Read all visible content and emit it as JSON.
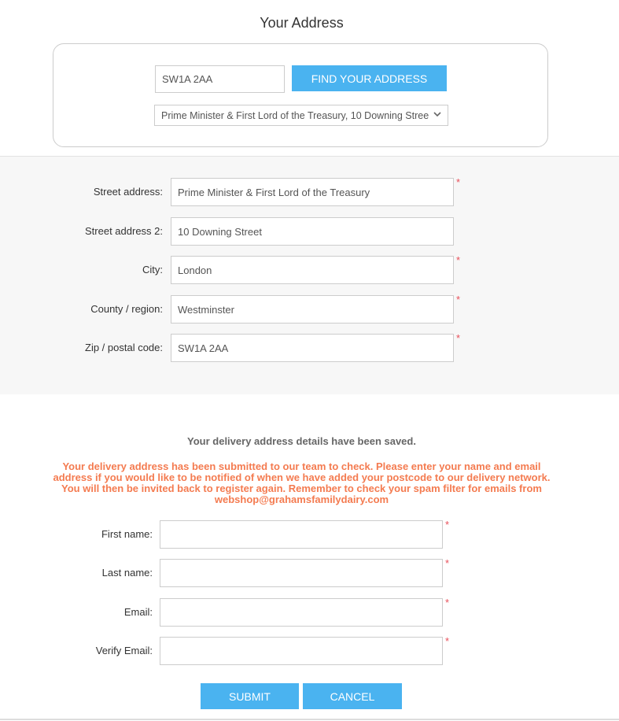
{
  "header": {
    "title": "Your Address"
  },
  "lookup": {
    "postcode_value": "SW1A 2AA",
    "find_button_label": "FIND YOUR ADDRESS",
    "selected_address": "Prime Minister & First Lord of the Treasury, 10 Downing Stree"
  },
  "address_fields": [
    {
      "label": "Street address:",
      "value": "Prime Minister & First Lord of the Treasury",
      "required": true
    },
    {
      "label": "Street address 2:",
      "value": "10 Downing Street",
      "required": false
    },
    {
      "label": "City:",
      "value": "London",
      "required": true
    },
    {
      "label": "County / region:",
      "value": "Westminster",
      "required": true
    },
    {
      "label": "Zip / postal code:",
      "value": "SW1A 2AA",
      "required": true
    }
  ],
  "messages": {
    "saved": "Your delivery address details have been saved.",
    "notice_lines": [
      "Your delivery address has been submitted to our team to check.  Please enter your name and email",
      "address if you would like to be notified of when we have added your postcode to our delivery network.",
      "You will then be invited back to register again.  Remember to check your spam filter for emails from",
      "webshop@grahamsfamilydairy.com"
    ]
  },
  "contact_fields": [
    {
      "label": "First name:",
      "value": "",
      "required": true
    },
    {
      "label": "Last name:",
      "value": "",
      "required": true
    },
    {
      "label": "Email:",
      "value": "",
      "required": true
    },
    {
      "label": "Verify Email:",
      "value": "",
      "required": true
    }
  ],
  "required_marker": "*",
  "dropdown_icon": "chevron-down-icon",
  "actions": {
    "submit_label": "SUBMIT",
    "cancel_label": "CANCEL"
  },
  "colors": {
    "accent": "#4ab3f0",
    "notice": "#f47b50",
    "required": "#e8505b"
  }
}
